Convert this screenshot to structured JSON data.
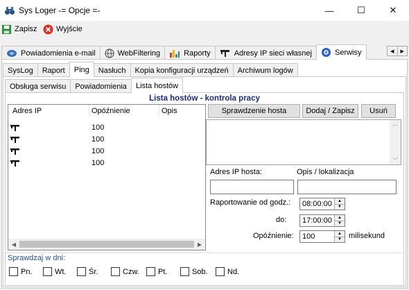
{
  "window": {
    "title": "Sys Loger -= Opcje =-",
    "controls": {
      "minimize": "—",
      "maximize": "☐",
      "close": "✕"
    }
  },
  "toolbar": {
    "save_label": "Zapisz",
    "exit_label": "Wyjście"
  },
  "main_tabs": [
    {
      "label": "Powiadomienia e-mail",
      "icon": "email-icon"
    },
    {
      "label": "WebFiltering",
      "icon": "globe-icon"
    },
    {
      "label": "Raporty",
      "icon": "chart-icon"
    },
    {
      "label": "Adresy IP sieci własnej",
      "icon": "network-icon"
    },
    {
      "label": "Serwisy",
      "icon": "service-icon"
    }
  ],
  "sub_tabs": [
    "SysLog",
    "Raport",
    "Ping",
    "Nasłuch",
    "Kopia konfiguracji urządzeń",
    "Archiwum logów"
  ],
  "sub_sub_tabs": [
    "Obsługa serwisu",
    "Powiadomienia",
    "Lista hostów"
  ],
  "section_title": "Lista hostów - kontrola pracy",
  "host_list": {
    "columns": [
      "Adres IP",
      "Opóźnienie",
      "Opis"
    ],
    "rows": [
      {
        "ip": "",
        "delay": "100",
        "desc": ""
      },
      {
        "ip": "",
        "delay": "100",
        "desc": ""
      },
      {
        "ip": "",
        "delay": "100",
        "desc": ""
      },
      {
        "ip": "",
        "delay": "100",
        "desc": ""
      }
    ]
  },
  "buttons": {
    "check_host": "Sprawdzenie hosta",
    "add_save": "Dodaj / Zapisz",
    "delete": "Usuń"
  },
  "form": {
    "ip_label": "Adres IP hosta:",
    "desc_label": "Opis / lokalizacja",
    "report_from_label": "Raportowanie od godz.:",
    "report_from_value": "08:00:00",
    "to_label": "do:",
    "to_value": "17:00:00",
    "delay_label": "Opóźnienie:",
    "delay_value": "100",
    "delay_unit": "milisekund"
  },
  "days": {
    "label": "Sprawdzaj w dni:",
    "items": [
      "Pn.",
      "Wt.",
      "Śr.",
      "Czw.",
      "Pt.",
      "Sob.",
      "Nd."
    ]
  }
}
